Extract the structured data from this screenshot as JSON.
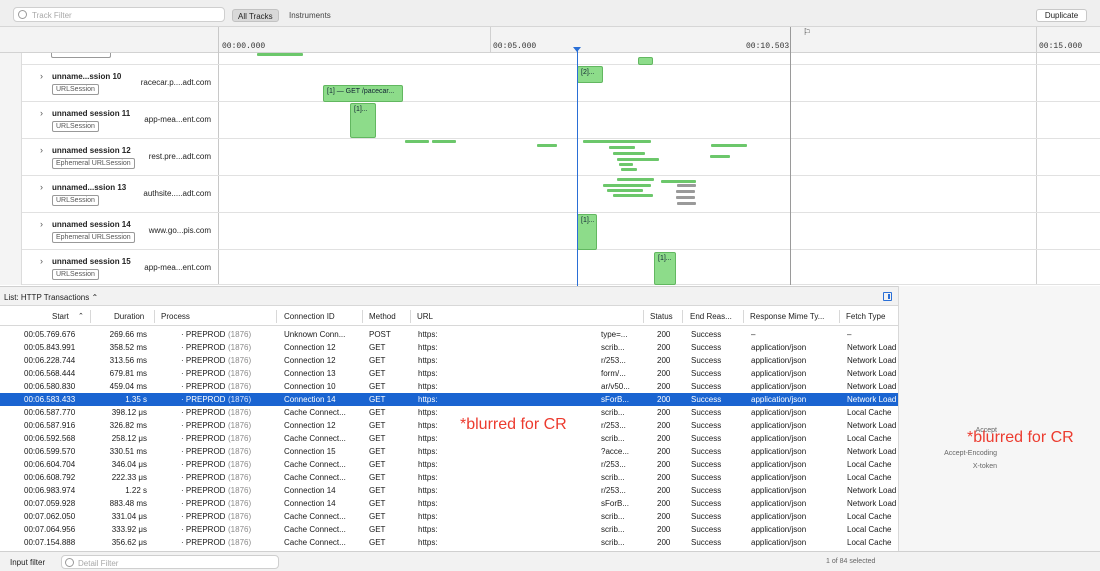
{
  "toolbar": {
    "track_filter_placeholder": "Track Filter",
    "all_tracks": "All Tracks",
    "instruments": "Instruments",
    "duplicate": "Duplicate"
  },
  "ruler": {
    "t0": "00:00.000",
    "t5": "00:05.000",
    "t10": "00:10.503",
    "t15": "00:15.000",
    "flag": "⚐"
  },
  "tracks": [
    {
      "name": "unname...ssion 10",
      "badge": "URLSession",
      "host": "racecar.p....adt.com"
    },
    {
      "name": "unnamed session 11",
      "badge": "URLSession",
      "host": "app-mea...ent.com"
    },
    {
      "name": "unnamed session 12",
      "badge": "Ephemeral URLSession",
      "host": "rest.pre...adt.com"
    },
    {
      "name": "unnamed...ssion 13",
      "badge": "URLSession",
      "host": "authsite.....adt.com"
    },
    {
      "name": "unnamed session 14",
      "badge": "Ephemeral URLSession",
      "host": "www.go...pis.com"
    },
    {
      "name": "unnamed session 15",
      "badge": "URLSession",
      "host": "app-mea...ent.com"
    }
  ],
  "bars": {
    "b10a": "[2]...",
    "b10b": "[1] — GET /pacecar...",
    "b11": "[1]...",
    "b14": "[1]...",
    "b15": "[1]..."
  },
  "list": {
    "title": "List: HTTP Transactions ⌃"
  },
  "columns": {
    "start": "Start",
    "duration": "Duration",
    "process": "Process",
    "connection": "Connection ID",
    "method": "Method",
    "url": "URL",
    "status": "Status",
    "end_reason": "End Reas...",
    "mime": "Response Mime Ty...",
    "fetch": "Fetch Type"
  },
  "rows": [
    {
      "start": "00:05.769.676",
      "dur": "269.66 ms",
      "proc": "· PREPROD",
      "pid": "(1876)",
      "conn": "Unknown Conn...",
      "method": "POST",
      "url": "https:",
      "url2": "type=...",
      "status": "200",
      "end": "Success",
      "mime": "–",
      "fetch": "–"
    },
    {
      "start": "00:05.843.991",
      "dur": "358.52 ms",
      "proc": "· PREPROD",
      "pid": "(1876)",
      "conn": "Connection 12",
      "method": "GET",
      "url": "https:",
      "url2": "scrib...",
      "status": "200",
      "end": "Success",
      "mime": "application/json",
      "fetch": "Network Load"
    },
    {
      "start": "00:06.228.744",
      "dur": "313.56 ms",
      "proc": "· PREPROD",
      "pid": "(1876)",
      "conn": "Connection 12",
      "method": "GET",
      "url": "https:",
      "url2": "r/253...",
      "status": "200",
      "end": "Success",
      "mime": "application/json",
      "fetch": "Network Load"
    },
    {
      "start": "00:06.568.444",
      "dur": "679.81 ms",
      "proc": "· PREPROD",
      "pid": "(1876)",
      "conn": "Connection 13",
      "method": "GET",
      "url": "https:",
      "url2": "form/...",
      "status": "200",
      "end": "Success",
      "mime": "application/json",
      "fetch": "Network Load"
    },
    {
      "start": "00:06.580.830",
      "dur": "459.04 ms",
      "proc": "· PREPROD",
      "pid": "(1876)",
      "conn": "Connection 10",
      "method": "GET",
      "url": "https:",
      "url2": "ar/v50...",
      "status": "200",
      "end": "Success",
      "mime": "application/json",
      "fetch": "Network Load"
    },
    {
      "start": "00:06.583.433",
      "dur": "1.35 s",
      "proc": "· PREPROD",
      "pid": "(1876)",
      "conn": "Connection 14",
      "method": "GET",
      "url": "https:",
      "url2": "sForB...",
      "status": "200",
      "end": "Success",
      "mime": "application/json",
      "fetch": "Network Load"
    },
    {
      "start": "00:06.587.770",
      "dur": "398.12 μs",
      "proc": "· PREPROD",
      "pid": "(1876)",
      "conn": "Cache Connect...",
      "method": "GET",
      "url": "https:",
      "url2": "scrib...",
      "status": "200",
      "end": "Success",
      "mime": "application/json",
      "fetch": "Local Cache"
    },
    {
      "start": "00:06.587.916",
      "dur": "326.82 ms",
      "proc": "· PREPROD",
      "pid": "(1876)",
      "conn": "Connection 12",
      "method": "GET",
      "url": "https:",
      "url2": "r/253...",
      "status": "200",
      "end": "Success",
      "mime": "application/json",
      "fetch": "Network Load"
    },
    {
      "start": "00:06.592.568",
      "dur": "258.12 μs",
      "proc": "· PREPROD",
      "pid": "(1876)",
      "conn": "Cache Connect...",
      "method": "GET",
      "url": "https:",
      "url2": "scrib...",
      "status": "200",
      "end": "Success",
      "mime": "application/json",
      "fetch": "Local Cache"
    },
    {
      "start": "00:06.599.570",
      "dur": "330.51 ms",
      "proc": "· PREPROD",
      "pid": "(1876)",
      "conn": "Connection 15",
      "method": "GET",
      "url": "https:",
      "url2": "?acce...",
      "status": "200",
      "end": "Success",
      "mime": "application/json",
      "fetch": "Network Load"
    },
    {
      "start": "00:06.604.704",
      "dur": "346.04 μs",
      "proc": "· PREPROD",
      "pid": "(1876)",
      "conn": "Cache Connect...",
      "method": "GET",
      "url": "https:",
      "url2": "r/253...",
      "status": "200",
      "end": "Success",
      "mime": "application/json",
      "fetch": "Local Cache"
    },
    {
      "start": "00:06.608.792",
      "dur": "222.33 μs",
      "proc": "· PREPROD",
      "pid": "(1876)",
      "conn": "Cache Connect...",
      "method": "GET",
      "url": "https:",
      "url2": "scrib...",
      "status": "200",
      "end": "Success",
      "mime": "application/json",
      "fetch": "Local Cache"
    },
    {
      "start": "00:06.983.974",
      "dur": "1.22 s",
      "proc": "· PREPROD",
      "pid": "(1876)",
      "conn": "Connection 14",
      "method": "GET",
      "url": "https:",
      "url2": "r/253...",
      "status": "200",
      "end": "Success",
      "mime": "application/json",
      "fetch": "Network Load"
    },
    {
      "start": "00:07.059.928",
      "dur": "883.48 ms",
      "proc": "· PREPROD",
      "pid": "(1876)",
      "conn": "Connection 14",
      "method": "GET",
      "url": "https:",
      "url2": "sForB...",
      "status": "200",
      "end": "Success",
      "mime": "application/json",
      "fetch": "Network Load"
    },
    {
      "start": "00:07.062.050",
      "dur": "331.04 μs",
      "proc": "· PREPROD",
      "pid": "(1876)",
      "conn": "Cache Connect...",
      "method": "GET",
      "url": "https:",
      "url2": "scrib...",
      "status": "200",
      "end": "Success",
      "mime": "application/json",
      "fetch": "Local Cache"
    },
    {
      "start": "00:07.064.956",
      "dur": "333.92 μs",
      "proc": "· PREPROD",
      "pid": "(1876)",
      "conn": "Cache Connect...",
      "method": "GET",
      "url": "https:",
      "url2": "scrib...",
      "status": "200",
      "end": "Success",
      "mime": "application/json",
      "fetch": "Local Cache"
    },
    {
      "start": "00:07.154.888",
      "dur": "356.62 μs",
      "proc": "· PREPROD",
      "pid": "(1876)",
      "conn": "Cache Connect...",
      "method": "GET",
      "url": "https:",
      "url2": "scrib...",
      "status": "200",
      "end": "Success",
      "mime": "application/json",
      "fetch": "Local Cache"
    }
  ],
  "blurred_label": "*blurred for CR",
  "headers_panel": {
    "accept": "Accept",
    "accept_encoding": "Accept-Encoding",
    "x_token": "X-token",
    "blurred": "*blurred for CR"
  },
  "footer": {
    "input_filter": "Input filter",
    "detail_placeholder": "Detail Filter",
    "selected": "1 of 84 selected"
  },
  "colors": {
    "selection": "#1a64d1",
    "bar": "#8ddc8a",
    "playhead": "#2a6fd6",
    "redact": "#ec3b2f"
  }
}
